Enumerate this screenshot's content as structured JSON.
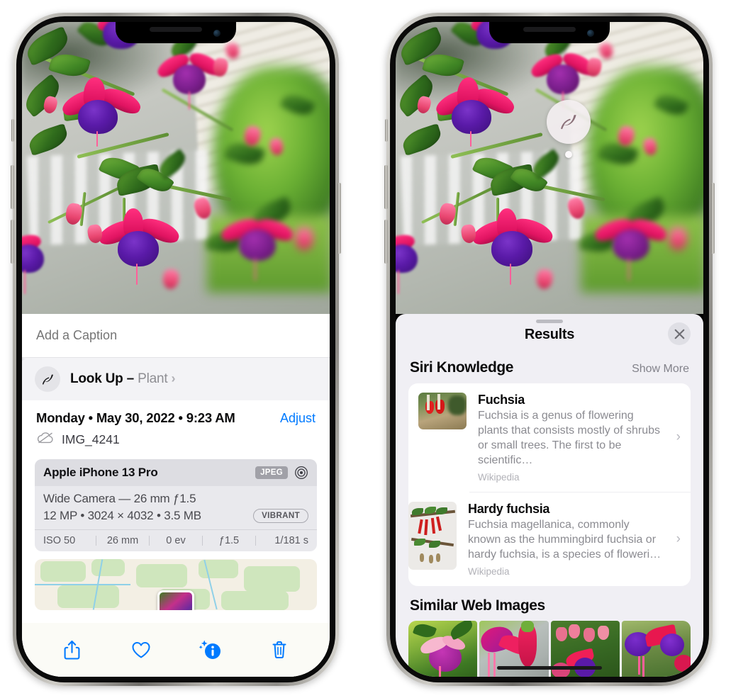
{
  "left_phone": {
    "caption": {
      "placeholder": "Add a Caption",
      "value": ""
    },
    "lookup": {
      "label": "Look Up – ",
      "subject": "Plant",
      "icon": "leaf-icon",
      "chevron": "›"
    },
    "meta": {
      "date": "Monday • May 30, 2022 • 9:23 AM",
      "adjust_label": "Adjust",
      "filename": "IMG_4241",
      "cloud_icon": "icloud-slash-icon"
    },
    "camera": {
      "device": "Apple iPhone 13 Pro",
      "format_badge": "JPEG",
      "aperture_icon": "aperture-icon",
      "lens": "Wide Camera — 26 mm ƒ1.5",
      "specs": "12 MP • 3024 × 4032 • 3.5 MB",
      "style_badge": "VIBRANT",
      "exif": [
        "ISO 50",
        "26 mm",
        "0 ev",
        "ƒ1.5",
        "1/181 s"
      ]
    },
    "toolbar": [
      {
        "name": "share-icon",
        "label": "Share"
      },
      {
        "name": "heart-icon",
        "label": "Favorite"
      },
      {
        "name": "info-sparkle-icon",
        "label": "Info"
      },
      {
        "name": "trash-icon",
        "label": "Delete"
      }
    ]
  },
  "right_phone": {
    "marker": {
      "icon": "leaf-icon"
    },
    "sheet": {
      "title": "Results",
      "close_icon": "close-icon",
      "sections": [
        {
          "title": "Siri Knowledge",
          "action": "Show More",
          "items": [
            {
              "title": "Fuchsia",
              "description": "Fuchsia is a genus of flowering plants that consists mostly of shrubs or small trees. The first to be scientific…",
              "source": "Wikipedia",
              "chevron": "›"
            },
            {
              "title": "Hardy fuchsia",
              "description": "Fuchsia magellanica, commonly known as the hummingbird fuchsia or hardy fuchsia, is a species of floweri…",
              "source": "Wikipedia",
              "chevron": "›"
            }
          ]
        },
        {
          "title": "Similar Web Images",
          "thumbnails": [
            {
              "name": "web-image-1"
            },
            {
              "name": "web-image-2"
            },
            {
              "name": "web-image-3"
            },
            {
              "name": "web-image-4"
            }
          ]
        }
      ]
    }
  },
  "colors": {
    "accent_blue": "#007aff",
    "sheet_bg": "#f0eff4",
    "card_bg": "#ffffff",
    "lookup_bg": "#f3f3f6",
    "camera_card_bg": "#e9e9ed",
    "secondary_text": "#8e8e93"
  }
}
